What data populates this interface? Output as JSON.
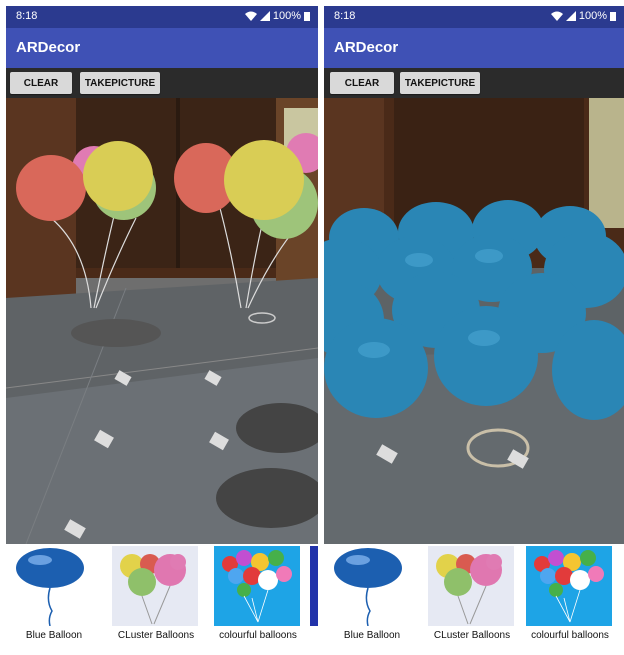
{
  "left": {
    "status": {
      "time": "8:18",
      "battery": "100%"
    },
    "app_title": "ARDecor",
    "buttons": {
      "clear": "CLEAR",
      "take_picture": "TAKEPICTURE"
    },
    "models": [
      {
        "label": "Blue Balloon",
        "icon": "blue-balloon-icon"
      },
      {
        "label": "CLuster Balloons",
        "icon": "cluster-balloons-icon"
      },
      {
        "label": "colourful balloons",
        "icon": "colourful-balloons-icon"
      }
    ]
  },
  "right": {
    "status": {
      "time": "8:18",
      "battery": "100%"
    },
    "app_title": "ARDecor",
    "buttons": {
      "clear": "CLEAR",
      "take_picture": "TAKEPICTURE"
    },
    "models": [
      {
        "label": "Blue Balloon",
        "icon": "blue-balloon-icon"
      },
      {
        "label": "CLuster Balloons",
        "icon": "cluster-balloons-icon"
      },
      {
        "label": "colourful balloons",
        "icon": "colourful-balloons-icon"
      }
    ]
  },
  "colors": {
    "status_bar": "#2b3a8f",
    "app_bar": "#3f51b5",
    "toolbar": "#2b2b2b",
    "button": "#d9d9d9",
    "blue_balloon": "#2a86b5"
  }
}
